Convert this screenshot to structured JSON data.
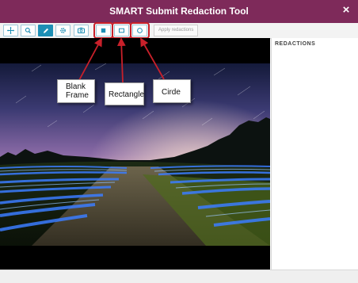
{
  "window": {
    "title": "SMART Submit Redaction Tool",
    "close_glyph": "×"
  },
  "toolbar": {
    "tools": [
      {
        "name": "move-tool",
        "icon": "move-arrows-icon"
      },
      {
        "name": "zoom-tool",
        "icon": "magnifier-icon"
      },
      {
        "name": "pen-tool",
        "icon": "pencil-icon",
        "active": true
      },
      {
        "name": "settings-tool",
        "icon": "gear-icon"
      },
      {
        "name": "camera-tool",
        "icon": "camera-icon"
      },
      {
        "name": "blank-frame-tool",
        "icon": "filled-square-icon"
      },
      {
        "name": "rectangle-tool",
        "icon": "rectangle-outline-icon"
      },
      {
        "name": "circle-tool",
        "icon": "circle-outline-icon"
      }
    ],
    "apply_label": "Apply redactions"
  },
  "sidebar": {
    "header": "REDACTIONS"
  },
  "callouts": {
    "blank_frame": "Blank\nFrame",
    "rectangle": "Rectangle",
    "circle": "Cirde"
  },
  "colors": {
    "titlebar": "#7e2a5a",
    "accent": "#1d8fb5",
    "highlight": "#c8202a"
  }
}
